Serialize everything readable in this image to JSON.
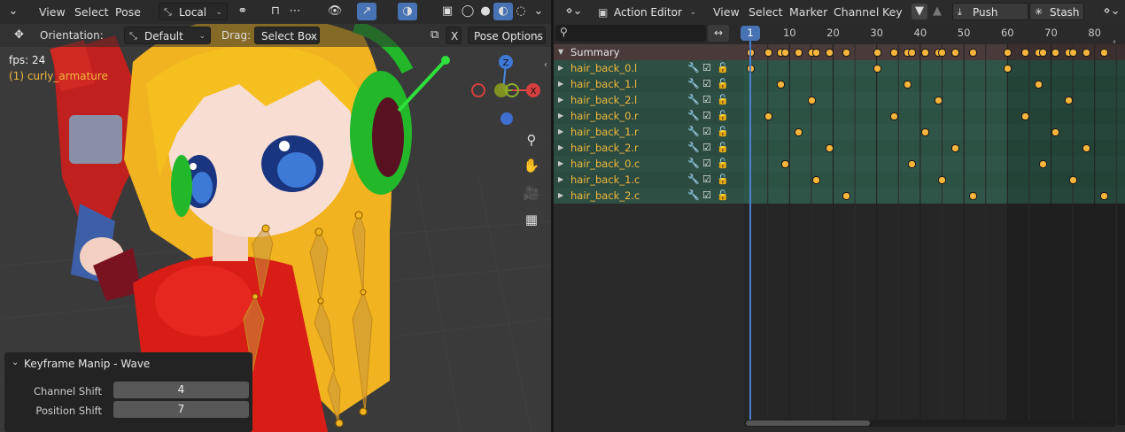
{
  "viewport": {
    "header": {
      "menus": [
        "View",
        "Select",
        "Pose"
      ],
      "transform_orientation": "Local"
    },
    "toolbar": {
      "orientation_label": "Orientation:",
      "orientation_value": "Default",
      "drag_label": "Drag:",
      "drag_value": "Select Box",
      "x_label": "X",
      "pose_options": "Pose Options"
    },
    "overlay": {
      "fps": "fps: 24",
      "object": "(1) curly_armature"
    },
    "gizmo": {
      "z": "Z",
      "x": "X"
    },
    "operator_panel": {
      "title": "Keyframe Manip - Wave",
      "fields": [
        {
          "label": "Channel Shift",
          "value": "4"
        },
        {
          "label": "Position Shift",
          "value": "7"
        }
      ]
    }
  },
  "editor": {
    "header": {
      "mode": "Action Editor",
      "menus": [
        "View",
        "Select",
        "Marker",
        "Channel",
        "Key"
      ],
      "push_down": "Push Down",
      "stash": "Stash"
    },
    "timeline": {
      "current_frame": "1",
      "ticks": [
        "10",
        "20",
        "30",
        "40",
        "50",
        "60",
        "70",
        "80"
      ]
    },
    "summary_label": "Summary",
    "channels": [
      {
        "name": "hair_back_0.l",
        "keys": [
          1,
          30,
          60
        ]
      },
      {
        "name": "hair_back_1.l",
        "keys": [
          8,
          37,
          67
        ]
      },
      {
        "name": "hair_back_2.l",
        "keys": [
          15,
          44,
          74
        ]
      },
      {
        "name": "hair_back_0.r",
        "keys": [
          5,
          34,
          64
        ]
      },
      {
        "name": "hair_back_1.r",
        "keys": [
          12,
          41,
          71
        ]
      },
      {
        "name": "hair_back_2.r",
        "keys": [
          19,
          48,
          78
        ]
      },
      {
        "name": "hair_back_0.c",
        "keys": [
          9,
          38,
          68
        ]
      },
      {
        "name": "hair_back_1.c",
        "keys": [
          16,
          45,
          75
        ]
      },
      {
        "name": "hair_back_2.c",
        "keys": [
          23,
          52,
          82
        ]
      }
    ],
    "colors": {
      "channel_label": "#f2b93d",
      "keyframe": "#f7b53b",
      "playhead": "#4c7fd1",
      "channel_band": "#2f5548",
      "summary_band": "#4a3a3a"
    }
  }
}
